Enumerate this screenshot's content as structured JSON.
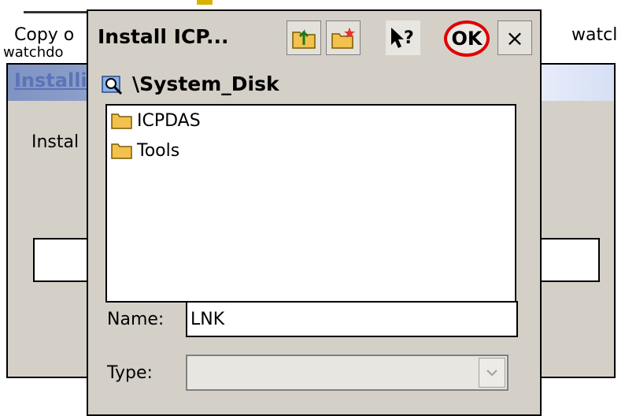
{
  "desktop": {
    "left_label_line1": "Copy o",
    "left_label_line2": "watchdo",
    "right_label": "watcl"
  },
  "bg_window": {
    "title": "Installi",
    "label": "Instal"
  },
  "dialog": {
    "title": "Install ICP...",
    "ok_label": "OK",
    "close_label": "×",
    "help_label": "?",
    "current_path": "\\System_Disk",
    "files": [
      {
        "name": "ICPDAS",
        "icon": "folder-icon"
      },
      {
        "name": "Tools",
        "icon": "folder-icon"
      }
    ],
    "name_label": "Name:",
    "name_value": "LNK",
    "type_label": "Type:",
    "type_value": ""
  },
  "colors": {
    "ok_highlight": "#e00000",
    "dialog_bg": "#d4d0c8",
    "folder": "#f2c14e"
  }
}
